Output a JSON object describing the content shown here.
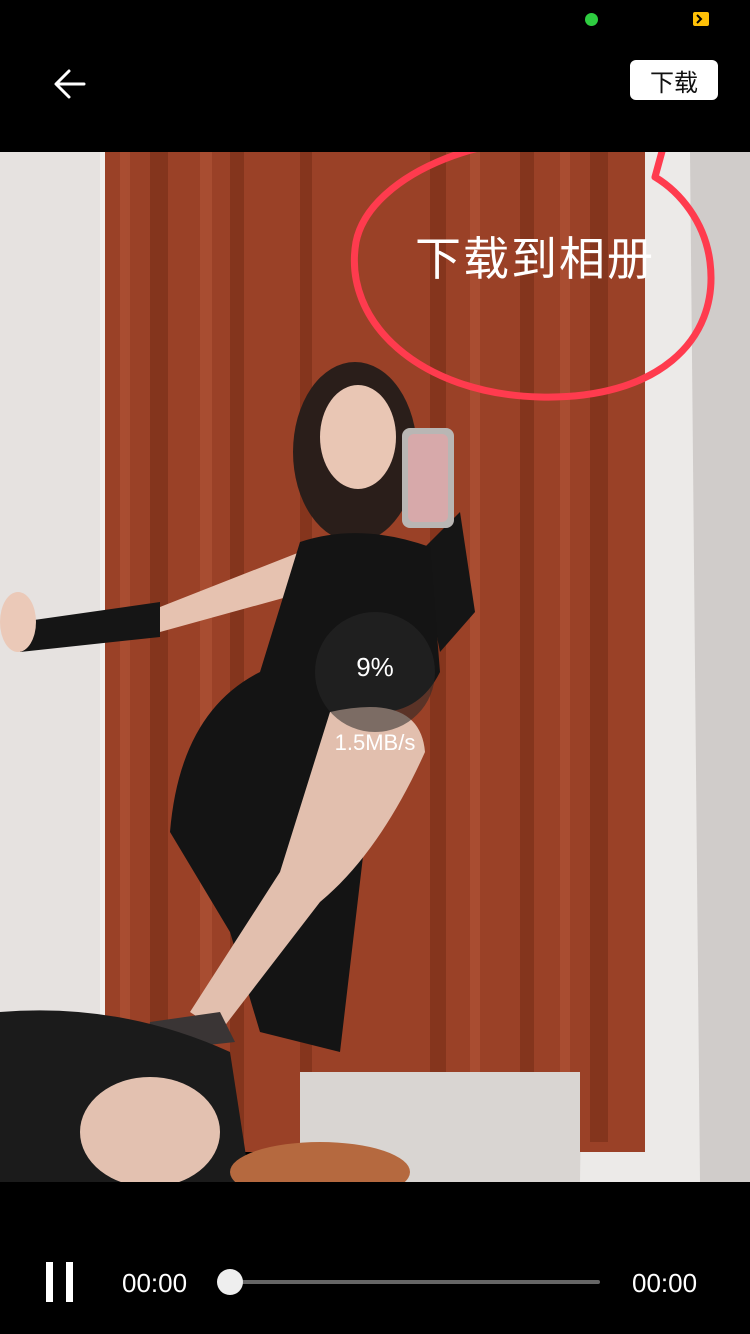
{
  "header": {
    "back_icon": "arrow-left-icon",
    "download_label": "下载"
  },
  "annotation": {
    "text": "下载到相册",
    "color": "#ff3b4e"
  },
  "progress": {
    "percent_label": "9%",
    "speed_label": "1.5MB/s",
    "value": 0.09
  },
  "player": {
    "current_time": "00:00",
    "total_time": "00:00",
    "pause_icon": "pause-icon",
    "position": 0
  },
  "colors": {
    "background": "#000000",
    "status_dot": "#2ecc40",
    "battery": "#ffc107",
    "curtain": "#9a4127"
  }
}
